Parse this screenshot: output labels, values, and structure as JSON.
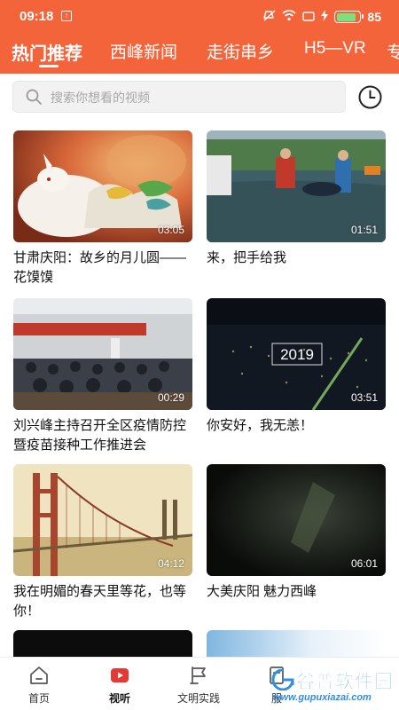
{
  "status_bar": {
    "time": "09:18",
    "battery": "85",
    "battery_level": 0.85
  },
  "tabs": [
    {
      "label": "热门推荐",
      "active": true
    },
    {
      "label": "西峰新闻",
      "active": false
    },
    {
      "label": "走街串乡",
      "active": false
    },
    {
      "label": "H5—VR",
      "active": false
    },
    {
      "label": "专",
      "active": false
    }
  ],
  "search": {
    "placeholder": "搜索你想看的视频"
  },
  "videos": [
    {
      "title": "甘肃庆阳：故乡的月儿圆——花馍馍",
      "duration": "03:05"
    },
    {
      "title": "来，把手给我",
      "duration": "01:51"
    },
    {
      "title": "刘兴峰主持召开全区疫情防控暨疫苗接种工作推进会",
      "duration": "00:29"
    },
    {
      "title": "你安好，我无恙！",
      "duration": "03:51",
      "overlay_text": "2019"
    },
    {
      "title": "我在明媚的春天里等花，也等你！",
      "duration": "04:12"
    },
    {
      "title": "大美庆阳  魅力西峰",
      "duration": "06:01"
    }
  ],
  "bottom_nav": [
    {
      "label": "首页",
      "icon": "home-icon",
      "active": false
    },
    {
      "label": "视听",
      "icon": "play-video-icon",
      "active": true
    },
    {
      "label": "文明实践",
      "icon": "flag-icon",
      "active": false
    },
    {
      "label": "服",
      "icon": "service-icon",
      "active": false
    }
  ],
  "watermark": {
    "name": "谷普软件园",
    "url": "www.gupuxiazai.com"
  },
  "colors": {
    "brand": "#f4643a",
    "active_tab_icon": "#e53935"
  }
}
